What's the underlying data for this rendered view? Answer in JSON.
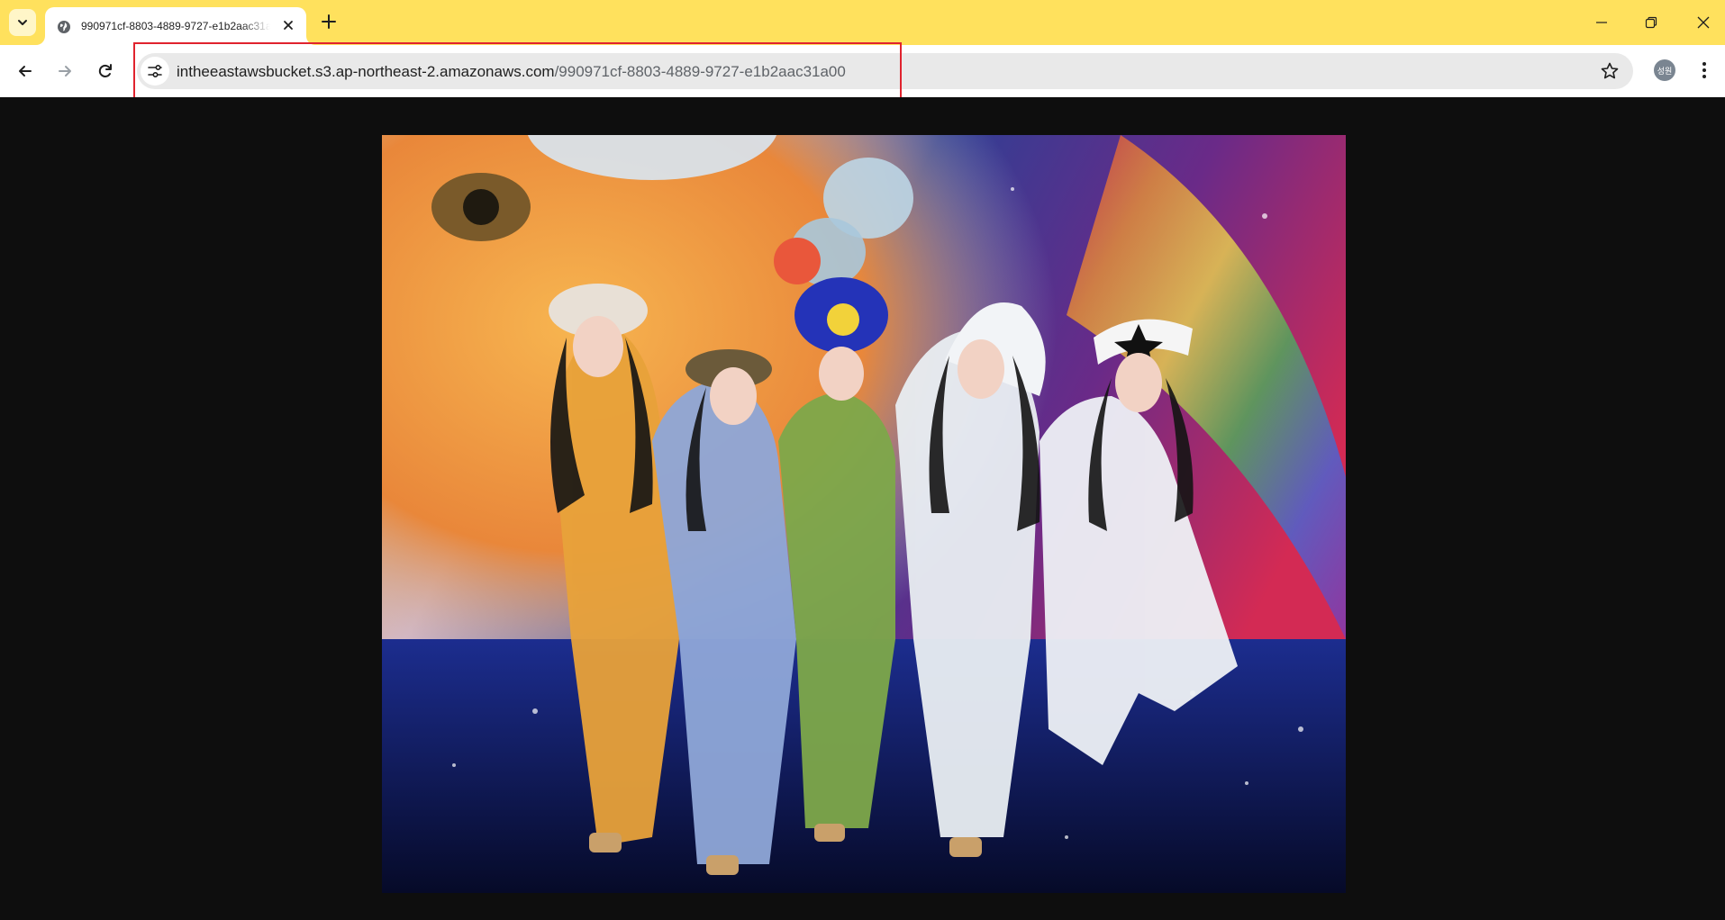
{
  "browser": {
    "tab": {
      "title": "990971cf-8803-4889-9727-e1b2aac31a00",
      "favicon": "globe-icon"
    },
    "omnibox": {
      "host": "intheeastawsbucket.s3.ap-northeast-2.amazonaws.com",
      "path": "/990971cf-8803-4889-9727-e1b2aac31a00"
    },
    "profile": {
      "initials": "성원"
    },
    "accent": "#ffe15d",
    "highlight_color": "#e0232e"
  },
  "content": {
    "image": {
      "kind": "photo",
      "background": "#0e0e0e"
    }
  }
}
